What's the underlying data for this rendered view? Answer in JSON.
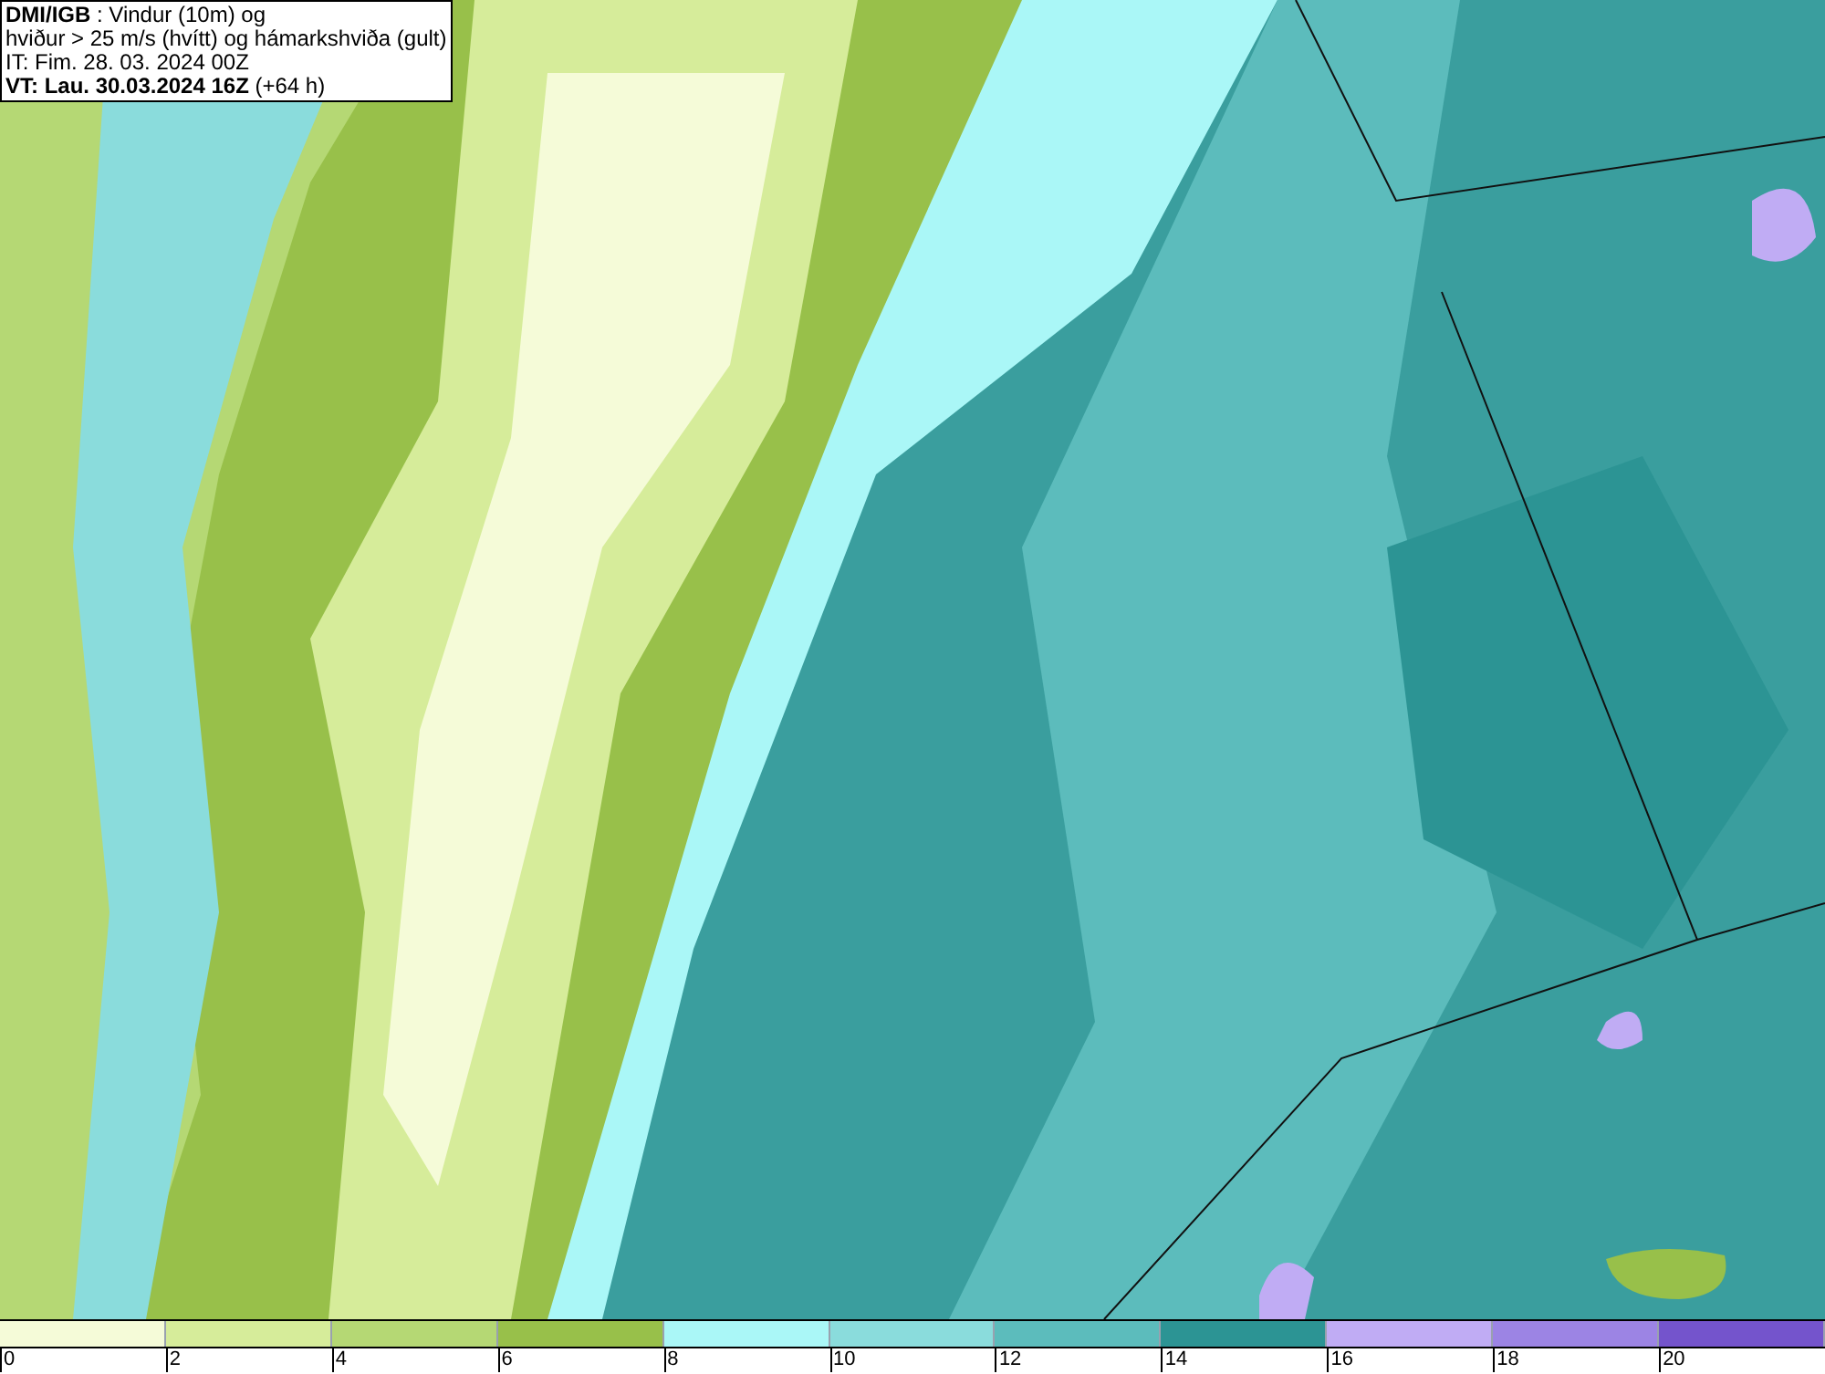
{
  "title_box": {
    "lines": [
      "**DMI/IGB** : Vindur (10m) og",
      "hviður > 25 m/s (hvítt) og hámarkshviða (gult)",
      "IT: Fim. 28. 03. 2024 00Z",
      "**VT: Lau. 30.03.2024 16Z** (+64 h)"
    ]
  },
  "legend": {
    "bins": [
      {
        "label": "0",
        "color": "#f5fbd8"
      },
      {
        "label": "2",
        "color": "#d6ec9a"
      },
      {
        "label": "4",
        "color": "#b5d874"
      },
      {
        "label": "6",
        "color": "#98c04a"
      },
      {
        "label": "8",
        "color": "#aaf7f7"
      },
      {
        "label": "10",
        "color": "#8adcdc"
      },
      {
        "label": "12",
        "color": "#5cbcbc"
      },
      {
        "label": "14",
        "color": "#2c9494"
      },
      {
        "label": "16",
        "color": "#c0acf4"
      },
      {
        "label": "18",
        "color": "#9c84e4"
      },
      {
        "label": "20",
        "color": "#7454cc"
      }
    ]
  }
}
